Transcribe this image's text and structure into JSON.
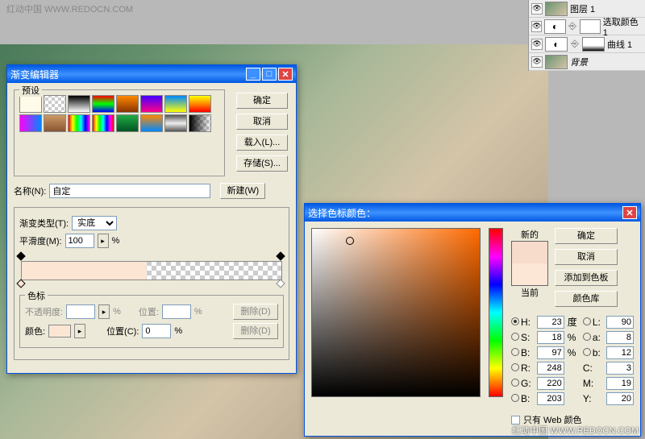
{
  "watermark": "红动中国 WWW.REDOCN.COM",
  "layers": [
    {
      "name": "图层 1",
      "type": "img"
    },
    {
      "name": "选取颜色 1",
      "type": "adj"
    },
    {
      "name": "曲线 1",
      "type": "adj"
    },
    {
      "name": "背景",
      "type": "img"
    }
  ],
  "grad": {
    "title": "渐变编辑器",
    "presets_label": "预设",
    "ok": "确定",
    "cancel": "取消",
    "load": "载入(L)...",
    "save": "存储(S)...",
    "name_lbl": "名称(N):",
    "name_val": "自定",
    "new": "新建(W)",
    "type_lbl": "渐变类型(T):",
    "type_val": "实底",
    "smooth_lbl": "平滑度(M):",
    "smooth_val": "100",
    "pct": "%",
    "stops_label": "色标",
    "opacity_lbl": "不透明度:",
    "pos_lbl": "位置:",
    "del": "删除(D)",
    "color_lbl": "颜色:",
    "posc_lbl": "位置(C):",
    "posc_val": "0"
  },
  "picker": {
    "title": "选择色标颜色：",
    "new": "新的",
    "current": "当前",
    "ok": "确定",
    "cancel": "取消",
    "addswatch": "添加到色板",
    "colorlib": "颜色库",
    "H": "23",
    "S": "18",
    "B": "97",
    "L": "90",
    "a": "8",
    "b": "12",
    "R": "248",
    "G": "220",
    "Bv": "203",
    "C": "3",
    "M": "19",
    "Y": "20",
    "webonly": "只有 Web 颜色",
    "deg": "度",
    "pct": "%",
    "new_color": "#f8dccb",
    "cur_color": "#fce6d6"
  }
}
